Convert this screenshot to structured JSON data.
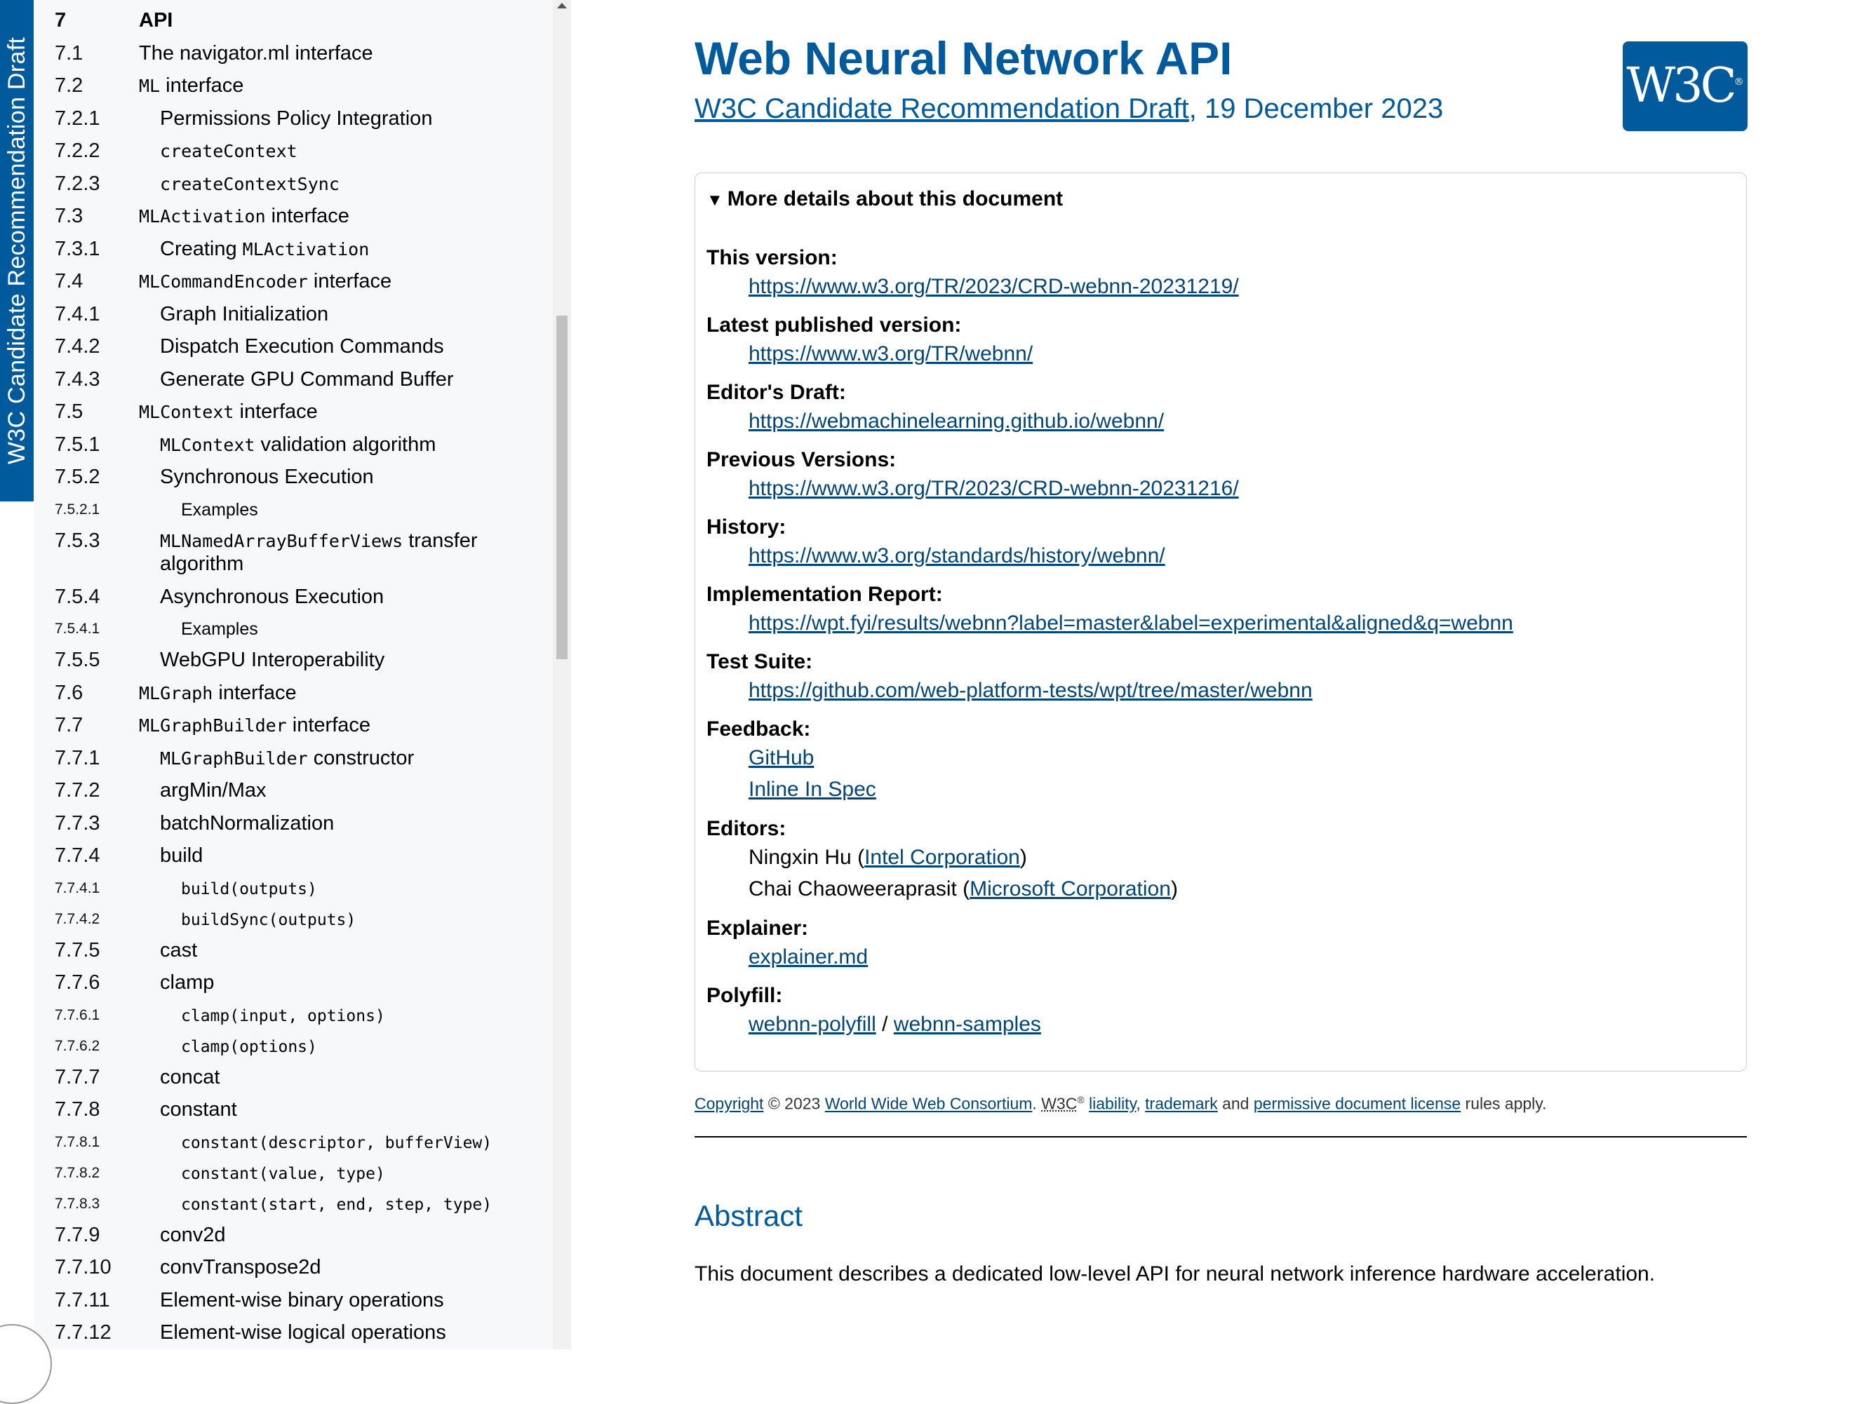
{
  "sidebar": {
    "status_label": "W3C Candidate Recommendation Draft",
    "toc": [
      {
        "num": "7",
        "parts": [
          {
            "t": "API"
          }
        ],
        "lvl": 1,
        "bold": true,
        "small": false
      },
      {
        "num": "7.1",
        "parts": [
          {
            "t": "The navigator.ml interface"
          }
        ],
        "lvl": 1,
        "small": false
      },
      {
        "num": "7.2",
        "parts": [
          {
            "t": "ML",
            "code": true
          },
          {
            "t": " interface"
          }
        ],
        "lvl": 1,
        "small": false
      },
      {
        "num": "7.2.1",
        "parts": [
          {
            "t": "Permissions Policy Integration"
          }
        ],
        "lvl": 2,
        "small": false
      },
      {
        "num": "7.2.2",
        "parts": [
          {
            "t": "createContext",
            "code": true
          }
        ],
        "lvl": 2,
        "small": false
      },
      {
        "num": "7.2.3",
        "parts": [
          {
            "t": "createContextSync",
            "code": true
          }
        ],
        "lvl": 2,
        "small": false
      },
      {
        "num": "7.3",
        "parts": [
          {
            "t": "MLActivation",
            "code": true
          },
          {
            "t": " interface"
          }
        ],
        "lvl": 1,
        "small": false
      },
      {
        "num": "7.3.1",
        "parts": [
          {
            "t": "Creating "
          },
          {
            "t": "MLActivation",
            "code": true
          }
        ],
        "lvl": 2,
        "small": false
      },
      {
        "num": "7.4",
        "parts": [
          {
            "t": "MLCommandEncoder",
            "code": true
          },
          {
            "t": " interface"
          }
        ],
        "lvl": 1,
        "small": false
      },
      {
        "num": "7.4.1",
        "parts": [
          {
            "t": "Graph Initialization"
          }
        ],
        "lvl": 2,
        "small": false
      },
      {
        "num": "7.4.2",
        "parts": [
          {
            "t": "Dispatch Execution Commands"
          }
        ],
        "lvl": 2,
        "small": false
      },
      {
        "num": "7.4.3",
        "parts": [
          {
            "t": "Generate GPU Command Buffer"
          }
        ],
        "lvl": 2,
        "small": false
      },
      {
        "num": "7.5",
        "parts": [
          {
            "t": "MLContext",
            "code": true
          },
          {
            "t": " interface"
          }
        ],
        "lvl": 1,
        "small": false
      },
      {
        "num": "7.5.1",
        "parts": [
          {
            "t": "MLContext",
            "code": true
          },
          {
            "t": " validation algorithm"
          }
        ],
        "lvl": 2,
        "small": false
      },
      {
        "num": "7.5.2",
        "parts": [
          {
            "t": "Synchronous Execution"
          }
        ],
        "lvl": 2,
        "small": false
      },
      {
        "num": "7.5.2.1",
        "parts": [
          {
            "t": "Examples"
          }
        ],
        "lvl": 3,
        "small": true
      },
      {
        "num": "7.5.3",
        "parts": [
          {
            "t": "MLNamedArrayBufferViews",
            "code": true
          },
          {
            "t": " transfer"
          }
        ],
        "lvl": 2,
        "small": false
      },
      {
        "num": "",
        "parts": [
          {
            "t": "algorithm"
          }
        ],
        "lvl": 2,
        "small": false
      },
      {
        "num": "7.5.4",
        "parts": [
          {
            "t": "Asynchronous Execution"
          }
        ],
        "lvl": 2,
        "small": false
      },
      {
        "num": "7.5.4.1",
        "parts": [
          {
            "t": "Examples"
          }
        ],
        "lvl": 3,
        "small": true
      },
      {
        "num": "7.5.5",
        "parts": [
          {
            "t": "WebGPU Interoperability"
          }
        ],
        "lvl": 2,
        "small": false
      },
      {
        "num": "7.6",
        "parts": [
          {
            "t": "MLGraph",
            "code": true
          },
          {
            "t": " interface"
          }
        ],
        "lvl": 1,
        "small": false
      },
      {
        "num": "7.7",
        "parts": [
          {
            "t": "MLGraphBuilder",
            "code": true
          },
          {
            "t": " interface"
          }
        ],
        "lvl": 1,
        "small": false
      },
      {
        "num": "7.7.1",
        "parts": [
          {
            "t": "MLGraphBuilder",
            "code": true
          },
          {
            "t": " constructor"
          }
        ],
        "lvl": 2,
        "small": false
      },
      {
        "num": "7.7.2",
        "parts": [
          {
            "t": "argMin/Max"
          }
        ],
        "lvl": 2,
        "small": false
      },
      {
        "num": "7.7.3",
        "parts": [
          {
            "t": "batchNormalization"
          }
        ],
        "lvl": 2,
        "small": false
      },
      {
        "num": "7.7.4",
        "parts": [
          {
            "t": "build"
          }
        ],
        "lvl": 2,
        "small": false
      },
      {
        "num": "7.7.4.1",
        "parts": [
          {
            "t": "build(outputs)",
            "code": true
          }
        ],
        "lvl": 3,
        "small": true
      },
      {
        "num": "7.7.4.2",
        "parts": [
          {
            "t": "buildSync(outputs)",
            "code": true
          }
        ],
        "lvl": 3,
        "small": true
      },
      {
        "num": "7.7.5",
        "parts": [
          {
            "t": "cast"
          }
        ],
        "lvl": 2,
        "small": false
      },
      {
        "num": "7.7.6",
        "parts": [
          {
            "t": "clamp"
          }
        ],
        "lvl": 2,
        "small": false
      },
      {
        "num": "7.7.6.1",
        "parts": [
          {
            "t": "clamp(input, options)",
            "code": true
          }
        ],
        "lvl": 3,
        "small": true
      },
      {
        "num": "7.7.6.2",
        "parts": [
          {
            "t": "clamp(options)",
            "code": true
          }
        ],
        "lvl": 3,
        "small": true
      },
      {
        "num": "7.7.7",
        "parts": [
          {
            "t": "concat"
          }
        ],
        "lvl": 2,
        "small": false
      },
      {
        "num": "7.7.8",
        "parts": [
          {
            "t": "constant"
          }
        ],
        "lvl": 2,
        "small": false
      },
      {
        "num": "7.7.8.1",
        "parts": [
          {
            "t": "constant(descriptor, bufferView)",
            "code": true
          }
        ],
        "lvl": 3,
        "small": true
      },
      {
        "num": "7.7.8.2",
        "parts": [
          {
            "t": "constant(value, type)",
            "code": true
          }
        ],
        "lvl": 3,
        "small": true
      },
      {
        "num": "7.7.8.3",
        "parts": [
          {
            "t": "constant(start, end, step, type)",
            "code": true
          }
        ],
        "lvl": 3,
        "small": true
      },
      {
        "num": "7.7.9",
        "parts": [
          {
            "t": "conv2d"
          }
        ],
        "lvl": 2,
        "small": false
      },
      {
        "num": "7.7.10",
        "parts": [
          {
            "t": "convTranspose2d"
          }
        ],
        "lvl": 2,
        "small": false
      },
      {
        "num": "7.7.11",
        "parts": [
          {
            "t": "Element-wise binary operations"
          }
        ],
        "lvl": 2,
        "small": false
      },
      {
        "num": "7.7.12",
        "parts": [
          {
            "t": "Element-wise logical operations"
          }
        ],
        "lvl": 2,
        "small": false
      }
    ]
  },
  "header": {
    "title": "Web Neural Network API",
    "subtitle_link": "W3C Candidate Recommendation Draft",
    "subtitle_rest": ", 19 December 2023",
    "logo_text": "W3C",
    "logo_reg": "®"
  },
  "details": {
    "summary": "More details about this document",
    "this_version_label": "This version:",
    "this_version_url": "https://www.w3.org/TR/2023/CRD-webnn-20231219/",
    "latest_label": "Latest published version:",
    "latest_url": "https://www.w3.org/TR/webnn/",
    "editors_draft_label": "Editor's Draft:",
    "editors_draft_url": "https://webmachinelearning.github.io/webnn/",
    "previous_label": "Previous Versions:",
    "previous_url": "https://www.w3.org/TR/2023/CRD-webnn-20231216/",
    "history_label": "History:",
    "history_url": "https://www.w3.org/standards/history/webnn/",
    "impl_label": "Implementation Report:",
    "impl_url": "https://wpt.fyi/results/webnn?label=master&label=experimental&aligned&q=webnn",
    "test_label": "Test Suite:",
    "test_url": "https://github.com/web-platform-tests/wpt/tree/master/webnn",
    "feedback_label": "Feedback:",
    "feedback_github": "GitHub",
    "feedback_inline": "Inline In Spec",
    "editors_label": "Editors:",
    "editor1_name": "Ningxin Hu (",
    "editor1_org": "Intel Corporation",
    "editor1_close": ")",
    "editor2_name": "Chai Chaoweeraprasit (",
    "editor2_org": "Microsoft Corporation",
    "editor2_close": ")",
    "explainer_label": "Explainer:",
    "explainer_link": "explainer.md",
    "polyfill_label": "Polyfill:",
    "polyfill_link1": "webnn-polyfill",
    "polyfill_sep": " / ",
    "polyfill_link2": "webnn-samples"
  },
  "copyright": {
    "link1": "Copyright",
    "text1": " © 2023 ",
    "link2": "World Wide Web Consortium",
    "text2": ". ",
    "w3c": "W3C",
    "reg": "®",
    "text3": " ",
    "link3": "liability",
    "text4": ", ",
    "link4": "trademark",
    "text5": " and ",
    "link5": "permissive document license",
    "text6": " rules apply."
  },
  "abstract": {
    "heading": "Abstract",
    "text": "This document describes a dedicated low-level API for neural network inference hardware acceleration."
  },
  "colors": {
    "accent": "#005a9c",
    "link": "#034575",
    "sidebar_bg": "#f7f8f9"
  }
}
